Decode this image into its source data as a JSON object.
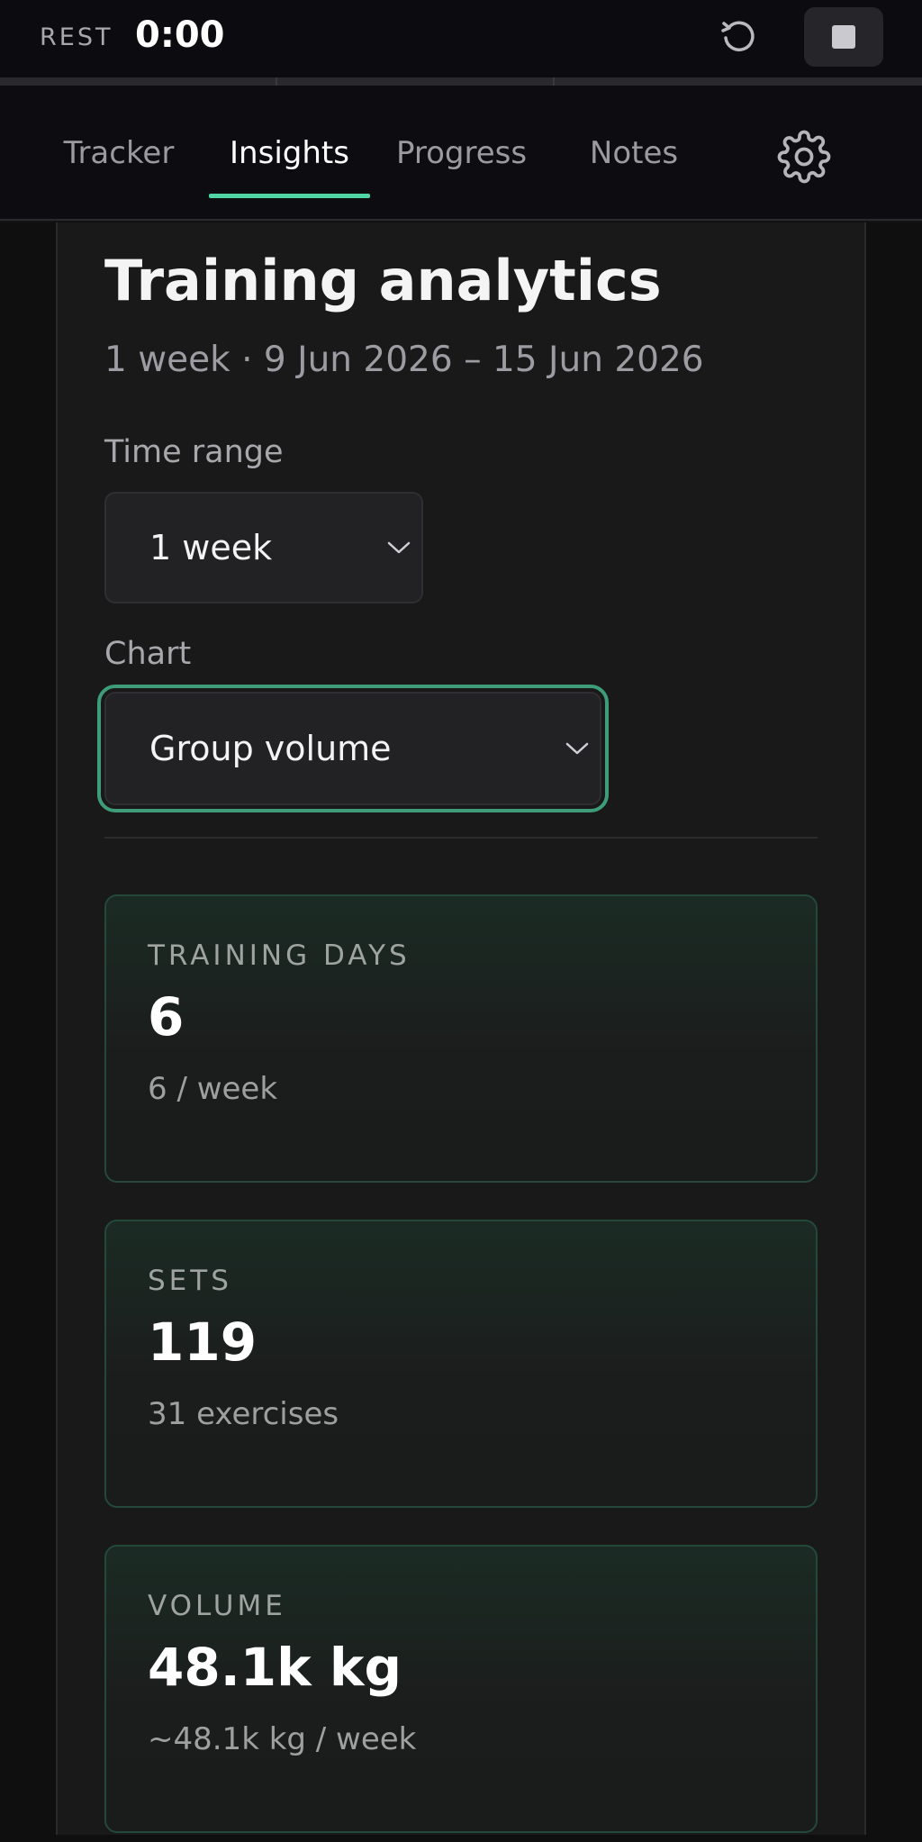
{
  "rest_timer": {
    "label": "REST",
    "time": "0:00"
  },
  "icons": {
    "reset": "reset-icon",
    "stop": "stop-icon",
    "settings": "gear-icon",
    "chevron": "chevron-down-icon"
  },
  "nav": {
    "tabs": [
      {
        "label": "Tracker",
        "active": false
      },
      {
        "label": "Insights",
        "active": true
      },
      {
        "label": "Progress",
        "active": false
      },
      {
        "label": "Notes",
        "active": false
      }
    ]
  },
  "colors": {
    "accent": "#4fd6a4",
    "focus_ring": "#3e9d78"
  },
  "page": {
    "title": "Training analytics",
    "subtitle": "1 week · 9 Jun 2026 – 15 Jun 2026"
  },
  "controls": {
    "time_range": {
      "label": "Time range",
      "value": "1 week"
    },
    "chart": {
      "label": "Chart",
      "value": "Group volume"
    }
  },
  "stats": [
    {
      "label": "TRAINING DAYS",
      "value": "6",
      "sub": "6 / week"
    },
    {
      "label": "SETS",
      "value": "119",
      "sub": "31 exercises"
    },
    {
      "label": "VOLUME",
      "value": "48.1k kg",
      "sub": "~48.1k kg / week"
    }
  ]
}
